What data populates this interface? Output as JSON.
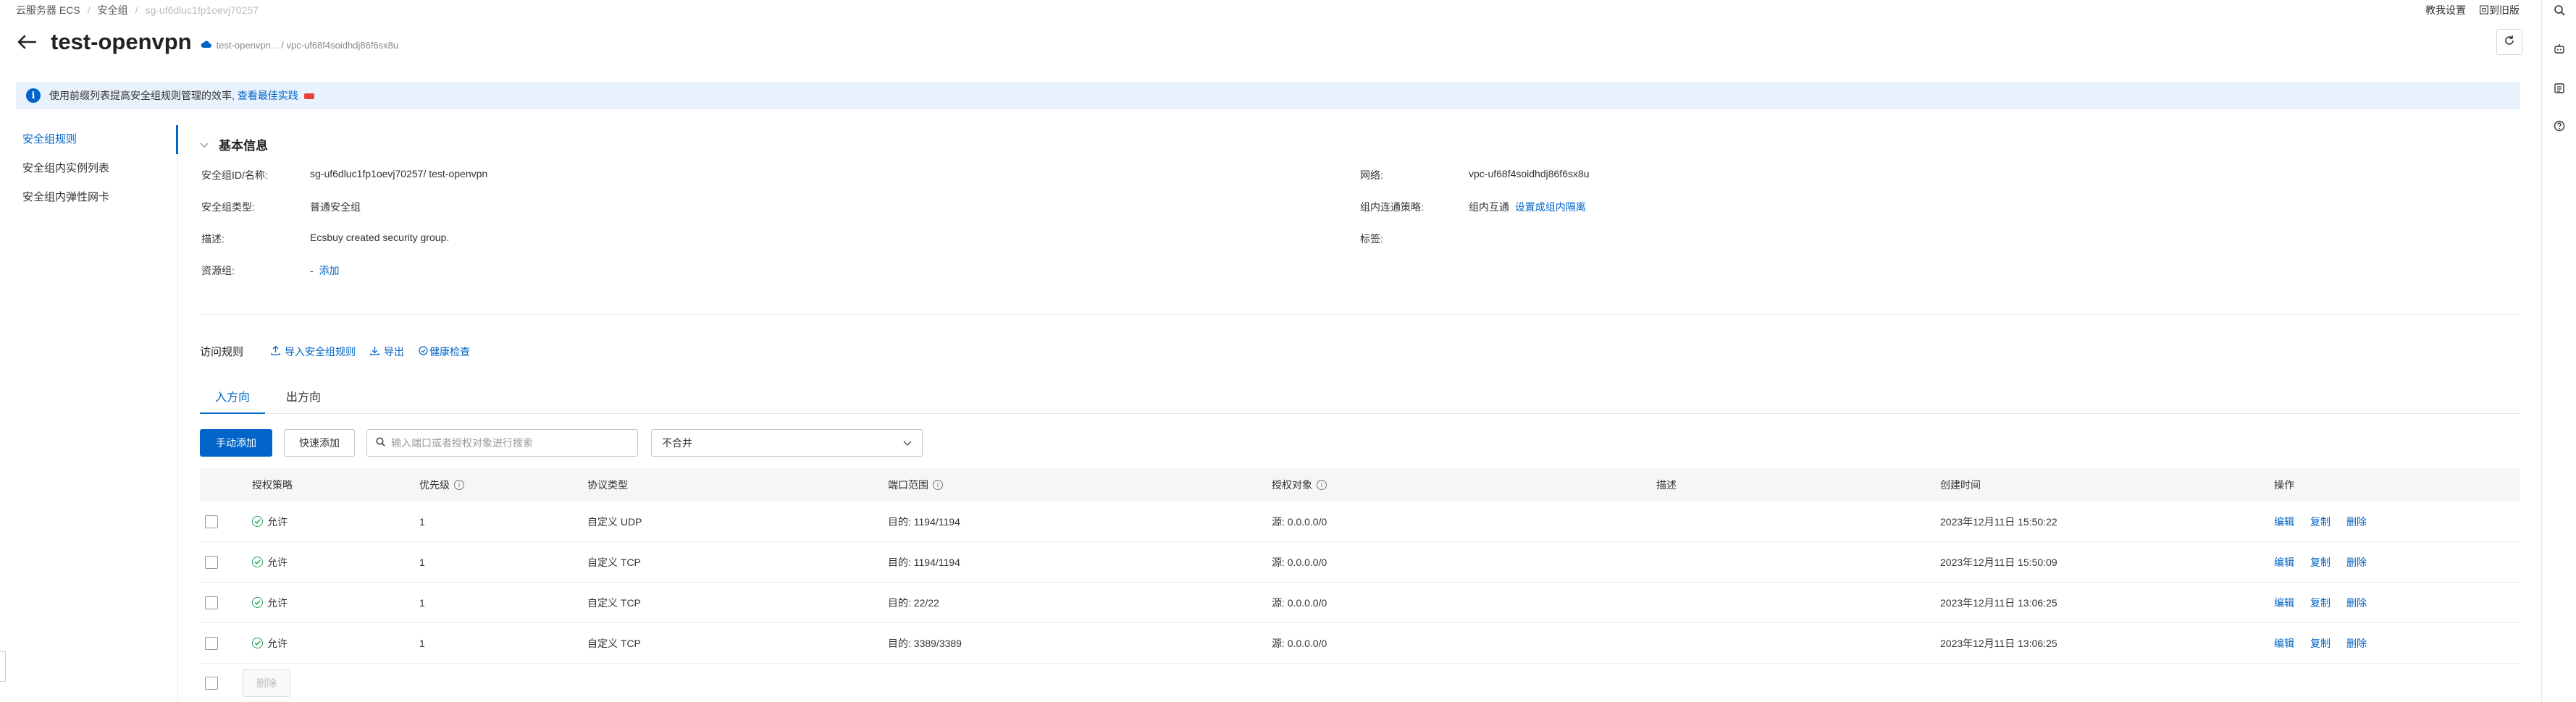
{
  "breadcrumb": [
    "云服务器 ECS",
    "安全组",
    "sg-uf6dluc1fp1oevj70257"
  ],
  "top_links": {
    "tutorial": "教我设置",
    "old_version": "回到旧版"
  },
  "header": {
    "title": "test-openvpn",
    "sub_text": "test-openvpn... / vpc-uf68f4soidhdj86f6sx8u"
  },
  "notice": {
    "text": "使用前缀列表提高安全组规则管理的效率,",
    "link": "查看最佳实践"
  },
  "nav": {
    "items": [
      "安全组规则",
      "安全组内实例列表",
      "安全组内弹性网卡"
    ]
  },
  "basic_info": {
    "title": "基本信息",
    "id_label": "安全组ID/名称:",
    "id_value": "sg-uf6dluc1fp1oevj70257/ test-openvpn",
    "type_label": "安全组类型:",
    "type_value": "普通安全组",
    "desc_label": "描述:",
    "desc_value": "Ecsbuy created security group.",
    "rg_label": "资源组:",
    "rg_dash": "-",
    "rg_add": "添加",
    "network_label": "网络:",
    "network_value": "vpc-uf68f4soidhdj86f6sx8u",
    "policy_label": "组内连通策略:",
    "policy_value": "组内互通",
    "policy_link": "设置成组内隔离",
    "tags_label": "标签:"
  },
  "rules": {
    "title": "访问规则",
    "import": "导入安全组规则",
    "export": "导出",
    "health": "健康检查"
  },
  "tabs": {
    "inbound": "入方向",
    "outbound": "出方向"
  },
  "toolbar": {
    "manual_add": "手动添加",
    "quick_add": "快速添加",
    "search_placeholder": "输入端口或者授权对象进行搜索",
    "merge_select": "不合并"
  },
  "table": {
    "headers": {
      "policy": "授权策略",
      "priority": "优先级",
      "protocol": "协议类型",
      "port": "端口范围",
      "target": "授权对象",
      "desc": "描述",
      "created": "创建时间",
      "ops": "操作"
    },
    "rows": [
      {
        "policy": "允许",
        "priority": "1",
        "protocol": "自定义 UDP",
        "port": "目的: 1194/1194",
        "target": "源: 0.0.0.0/0",
        "desc": "",
        "created": "2023年12月11日 15:50:22"
      },
      {
        "policy": "允许",
        "priority": "1",
        "protocol": "自定义 TCP",
        "port": "目的: 1194/1194",
        "target": "源: 0.0.0.0/0",
        "desc": "",
        "created": "2023年12月11日 15:50:09"
      },
      {
        "policy": "允许",
        "priority": "1",
        "protocol": "自定义 TCP",
        "port": "目的: 22/22",
        "target": "源: 0.0.0.0/0",
        "desc": "",
        "created": "2023年12月11日 13:06:25"
      },
      {
        "policy": "允许",
        "priority": "1",
        "protocol": "自定义 TCP",
        "port": "目的: 3389/3389",
        "target": "源: 0.0.0.0/0",
        "desc": "",
        "created": "2023年12月11日 13:06:25"
      }
    ],
    "ops": {
      "edit": "编辑",
      "copy": "复制",
      "delete": "删除"
    }
  },
  "footer": {
    "delete": "删除"
  }
}
